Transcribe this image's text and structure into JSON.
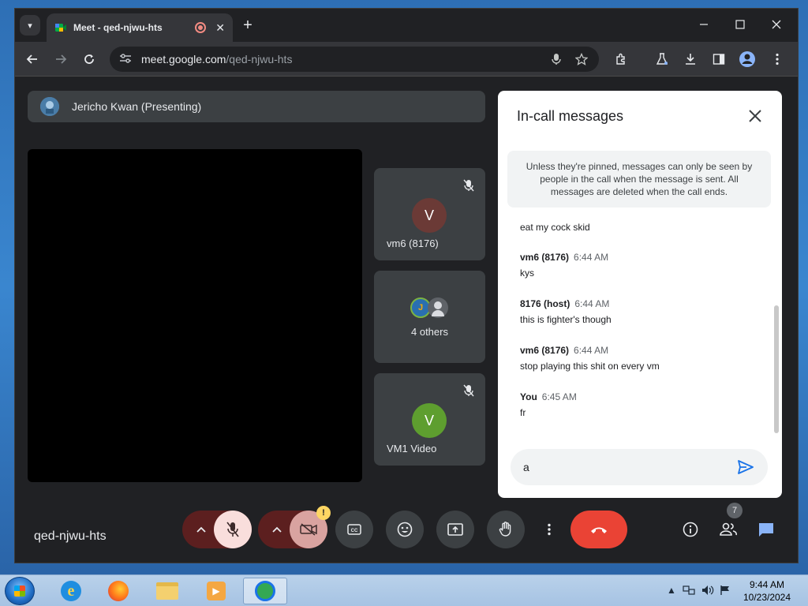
{
  "browser": {
    "tab_title": "Meet - qed-njwu-hts",
    "tab_close": "✕",
    "new_tab": "+",
    "url_host": "meet.google.com",
    "url_path": "/qed-njwu-hts"
  },
  "meet": {
    "presenter": "Jericho Kwan (Presenting)",
    "tiles": [
      {
        "avatar_letter": "V",
        "label": "vm6 (8176)",
        "avatar_color": "#6b3a36"
      },
      {
        "label": "4 others",
        "avatar_letter_1": "J"
      },
      {
        "avatar_letter": "V",
        "label": "VM1 Video",
        "avatar_color": "#5e9e2f"
      }
    ],
    "meeting_code": "qed-njwu-hts",
    "people_count": "7",
    "camera_warning": "!"
  },
  "chat": {
    "title": "In-call messages",
    "notice": "Unless they're pinned, messages can only be seen by people in the call when the message is sent. All messages are deleted when the call ends.",
    "first_text": "eat my cock skid",
    "messages": [
      {
        "sender": "vm6 (8176)",
        "time": "6:44 AM",
        "text": "kys"
      },
      {
        "sender": "8176 (host)",
        "time": "6:44 AM",
        "text": "this is fighter's though"
      },
      {
        "sender": "vm6 (8176)",
        "time": "6:44 AM",
        "text": "stop playing this shit on every vm"
      },
      {
        "sender": "You",
        "time": "6:45 AM",
        "text": "fr"
      }
    ],
    "input_value": "a"
  },
  "taskbar": {
    "time": "9:44 AM",
    "date": "10/23/2024",
    "ie_glyph": "e"
  },
  "colors": {
    "end_call": "#ea4335",
    "accent": "#1a73e8",
    "mic_off_bg": "#f9dedc"
  }
}
